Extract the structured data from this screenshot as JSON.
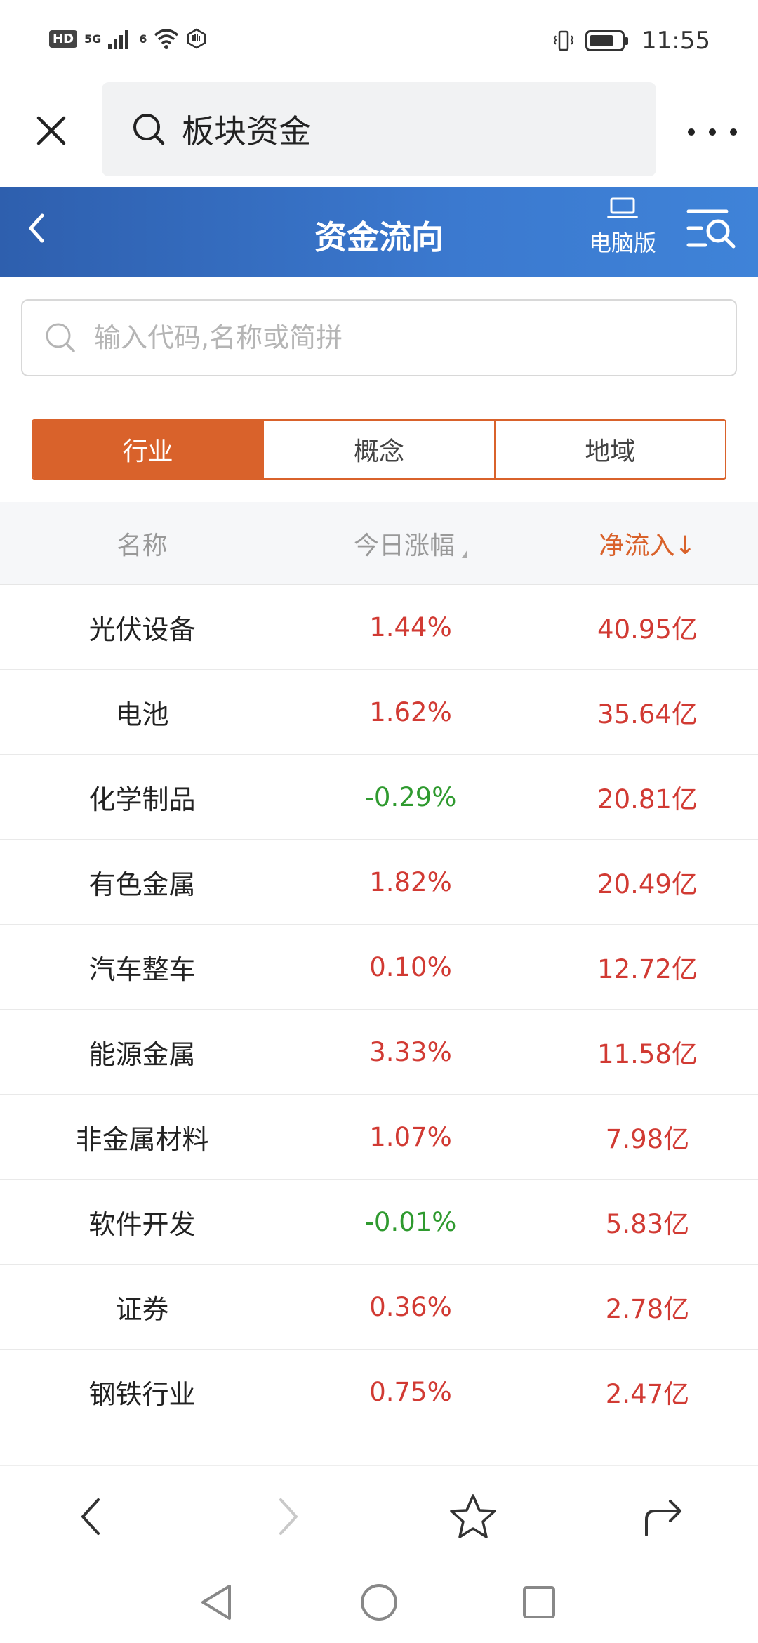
{
  "status_bar": {
    "hd": "HD",
    "network": "5G",
    "wifi_gen": "6",
    "time": "11:55",
    "battery_level": 0.78
  },
  "browser": {
    "url_text": "板块资金"
  },
  "header": {
    "title": "资金流向",
    "pc_label": "电脑版",
    "color_start": "#2e5fae",
    "color_end": "#3f83d8"
  },
  "search": {
    "placeholder": "输入代码,名称或简拼",
    "value": ""
  },
  "tabs": [
    {
      "label": "行业",
      "active": true
    },
    {
      "label": "概念",
      "active": false
    },
    {
      "label": "地域",
      "active": false
    }
  ],
  "table": {
    "columns": {
      "name": "名称",
      "change": "今日涨幅",
      "flow": "净流入↓"
    },
    "rows": [
      {
        "name": "光伏设备",
        "change": "1.44%",
        "flow": "40.95亿"
      },
      {
        "name": "电池",
        "change": "1.62%",
        "flow": "35.64亿"
      },
      {
        "name": "化学制品",
        "change": "-0.29%",
        "flow": "20.81亿"
      },
      {
        "name": "有色金属",
        "change": "1.82%",
        "flow": "20.49亿"
      },
      {
        "name": "汽车整车",
        "change": "0.10%",
        "flow": "12.72亿"
      },
      {
        "name": "能源金属",
        "change": "3.33%",
        "flow": "11.58亿"
      },
      {
        "name": "非金属材料",
        "change": "1.07%",
        "flow": "7.98亿"
      },
      {
        "name": "软件开发",
        "change": "-0.01%",
        "flow": "5.83亿"
      },
      {
        "name": "证券",
        "change": "0.36%",
        "flow": "2.78亿"
      },
      {
        "name": "钢铁行业",
        "change": "0.75%",
        "flow": "2.47亿"
      }
    ]
  },
  "colors": {
    "accent": "#d9622b",
    "up": "#d13a33",
    "down": "#2f9a2f"
  },
  "icons": {
    "close": "close-icon",
    "search": "search-icon",
    "more": "more-icon",
    "back": "chevron-left-icon",
    "pc": "laptop-icon",
    "menu_search": "menu-search-icon",
    "nav_back": "nav-back-icon",
    "nav_forward": "nav-forward-icon",
    "star": "star-icon",
    "share": "share-icon"
  }
}
